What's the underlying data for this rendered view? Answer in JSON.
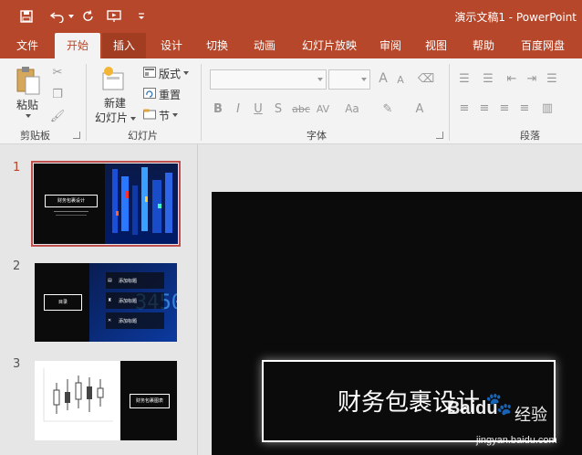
{
  "window": {
    "title": "演示文稿1 - PowerPoint"
  },
  "quick_access": {
    "items": [
      "save-icon",
      "undo-icon",
      "redo-icon",
      "present-icon",
      "customize-icon"
    ]
  },
  "tabs": [
    "文件",
    "开始",
    "插入",
    "设计",
    "切换",
    "动画",
    "幻灯片放映",
    "审阅",
    "视图",
    "帮助",
    "百度网盘"
  ],
  "active_tab": "开始",
  "ribbon": {
    "clipboard": {
      "paste": "粘贴",
      "label": "剪贴板"
    },
    "slides": {
      "new_slide_line1": "新建",
      "new_slide_line2": "幻灯片",
      "layout": "版式",
      "reset": "重置",
      "section": "节",
      "label": "幻灯片"
    },
    "font": {
      "label": "字体",
      "grow": "A",
      "shrink": "A",
      "bold": "B",
      "italic": "I",
      "underline": "U",
      "shadow": "S",
      "strike": "abc",
      "spacing": "AV",
      "case": "Aa",
      "color": "A"
    },
    "paragraph": {
      "label": "段落"
    }
  },
  "thumbnails": [
    {
      "number": "1",
      "title": "财务包裹设计",
      "selected": true
    },
    {
      "number": "2",
      "title": "目录",
      "items": [
        "添加标题",
        "添加标题",
        "添加标题"
      ],
      "selected": false
    },
    {
      "number": "3",
      "title": "财务包裹图表",
      "selected": false
    }
  ],
  "slide": {
    "title": "财务包裹设计"
  },
  "watermark": {
    "brand": "Baidu",
    "brand_cn": "经验",
    "url": "jingyan.baidu.com"
  },
  "colors": {
    "accent": "#b7472a",
    "ribbon": "#f3f3f3",
    "pane": "#e6e6e6",
    "slide_bg": "#0b0b0b"
  }
}
